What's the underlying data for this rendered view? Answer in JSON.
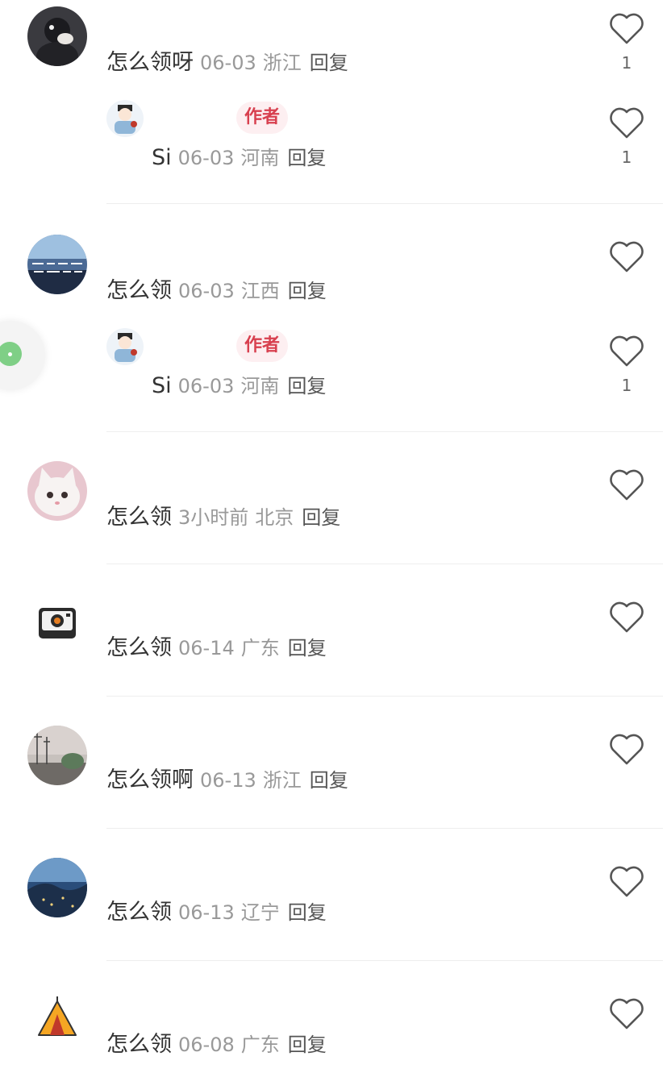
{
  "author_tag": "作者",
  "reply_label": "回复",
  "comments": [
    {
      "avatar": "dark-avatar",
      "text": "怎么领呀",
      "date": "06-03",
      "location": "浙江",
      "likes": "1",
      "reply": {
        "avatar": "cartoon-avatar",
        "text": "Si",
        "date": "06-03",
        "location": "河南",
        "likes": "1"
      }
    },
    {
      "avatar": "skyline-calligraphy-avatar",
      "text": "怎么领",
      "date": "06-03",
      "location": "江西",
      "likes": "",
      "reply": {
        "avatar": "cartoon-avatar",
        "text": "Si",
        "date": "06-03",
        "location": "河南",
        "likes": "1"
      }
    },
    {
      "avatar": "white-cat-avatar",
      "text": "怎么领",
      "date": "3小时前",
      "location": "北京",
      "likes": ""
    },
    {
      "avatar": "camera-avatar",
      "text": "怎么领",
      "date": "06-14",
      "location": "广东",
      "likes": ""
    },
    {
      "avatar": "street-scene-avatar",
      "text": "怎么领啊",
      "date": "06-13",
      "location": "浙江",
      "likes": ""
    },
    {
      "avatar": "night-view-avatar",
      "text": "怎么领",
      "date": "06-13",
      "location": "辽宁",
      "likes": ""
    },
    {
      "avatar": "tent-avatar",
      "text": "怎么领",
      "date": "06-08",
      "location": "广东",
      "likes": ""
    }
  ],
  "colors": {
    "meta": "#999999",
    "text": "#333333",
    "author_tag_bg": "#fdeff1",
    "author_tag_text": "#d8404f",
    "divider": "#eeeeee",
    "float_button": "#7fcf86"
  }
}
